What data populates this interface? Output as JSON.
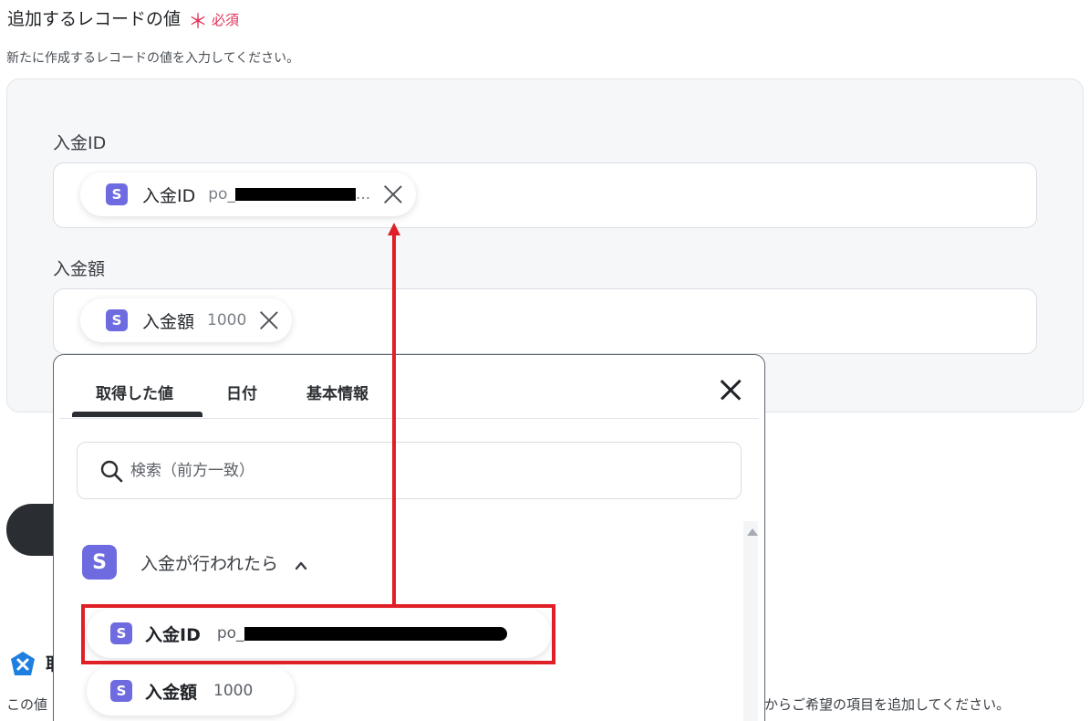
{
  "section": {
    "title": "追加するレコードの値",
    "required_mark": "＊",
    "required_label": "必須",
    "description": "新たに作成するレコードの値を入力してください。"
  },
  "fields": [
    {
      "label": "入金ID",
      "chip": {
        "name": "入金ID",
        "value_prefix": "po_",
        "value_suffix": "..."
      }
    },
    {
      "label": "入金額",
      "chip": {
        "name": "入金額",
        "value": "1000"
      }
    }
  ],
  "popup": {
    "tabs": [
      {
        "label": "取得した値",
        "active": true
      },
      {
        "label": "日付",
        "active": false
      },
      {
        "label": "基本情報",
        "active": false
      }
    ],
    "search_placeholder": "検索（前方一致）",
    "group": {
      "title": "入金が行われたら",
      "icon_letter": "S"
    },
    "options": [
      {
        "name": "入金ID",
        "value_prefix": "po_"
      },
      {
        "name": "入金額",
        "value": "1000"
      }
    ]
  },
  "info": {
    "title": "取",
    "text_left": "この値",
    "text_right": "からご希望の項目を追加してください。"
  },
  "icons": {
    "app_icon_letter": "S",
    "app_color": "#6e6adf",
    "accent_red": "#e01f26",
    "required_color": "#e23257"
  }
}
